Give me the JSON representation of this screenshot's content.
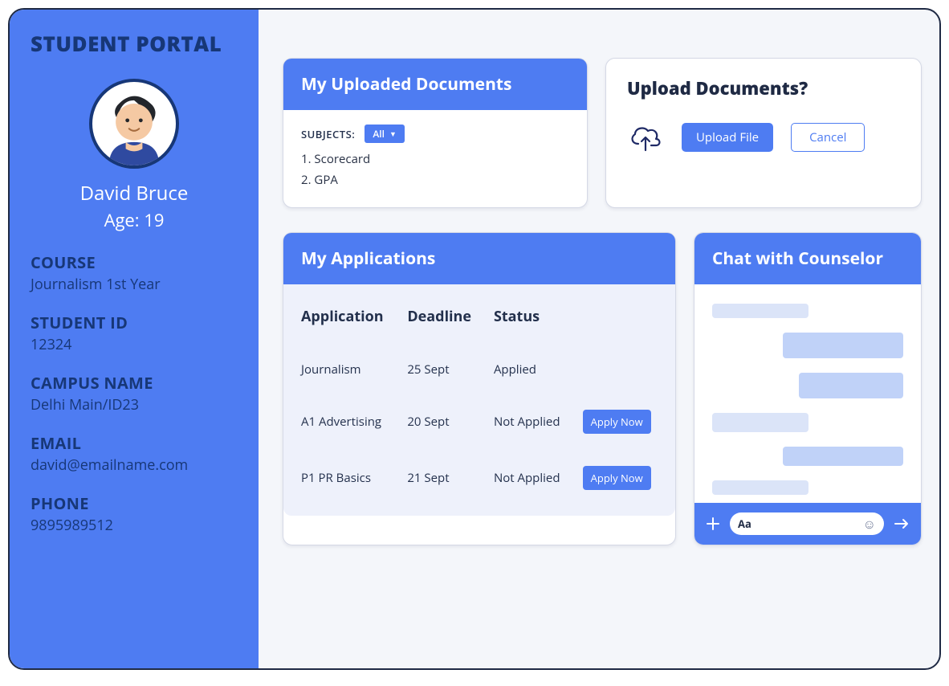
{
  "sidebar": {
    "title": "STUDENT PORTAL",
    "name": "David Bruce",
    "age_line": "Age: 19",
    "fields": {
      "course_label": "COURSE",
      "course_value": "Journalism 1st Year",
      "id_label": "STUDENT ID",
      "id_value": "12324",
      "campus_label": "CAMPUS NAME",
      "campus_value": "Delhi Main/ID23",
      "email_label": "EMAIL",
      "email_value": "david@emailname.com",
      "phone_label": "PHONE",
      "phone_value": "9895989512"
    }
  },
  "docs": {
    "title": "My Uploaded Documents",
    "subjects_label": "SUBJECTS:",
    "filter_label": "All",
    "items": [
      {
        "text": "1. Scorecard"
      },
      {
        "text": "2. GPA"
      }
    ]
  },
  "upload": {
    "title": "Upload Documents?",
    "upload_label": "Upload File",
    "cancel_label": "Cancel"
  },
  "applications": {
    "title": "My Applications",
    "headers": {
      "app": "Application",
      "deadline": "Deadline",
      "status": "Status"
    },
    "apply_label": "Apply Now",
    "rows": [
      {
        "app": "Journalism",
        "deadline": "25 Sept",
        "status": "Applied",
        "can_apply": false
      },
      {
        "app": "A1 Advertising",
        "deadline": "20 Sept",
        "status": "Not Applied",
        "can_apply": true
      },
      {
        "app": "P1 PR Basics",
        "deadline": "21 Sept",
        "status": "Not Applied",
        "can_apply": true
      }
    ]
  },
  "chat": {
    "title": "Chat with Counselor",
    "input_placeholder": "Aa"
  }
}
